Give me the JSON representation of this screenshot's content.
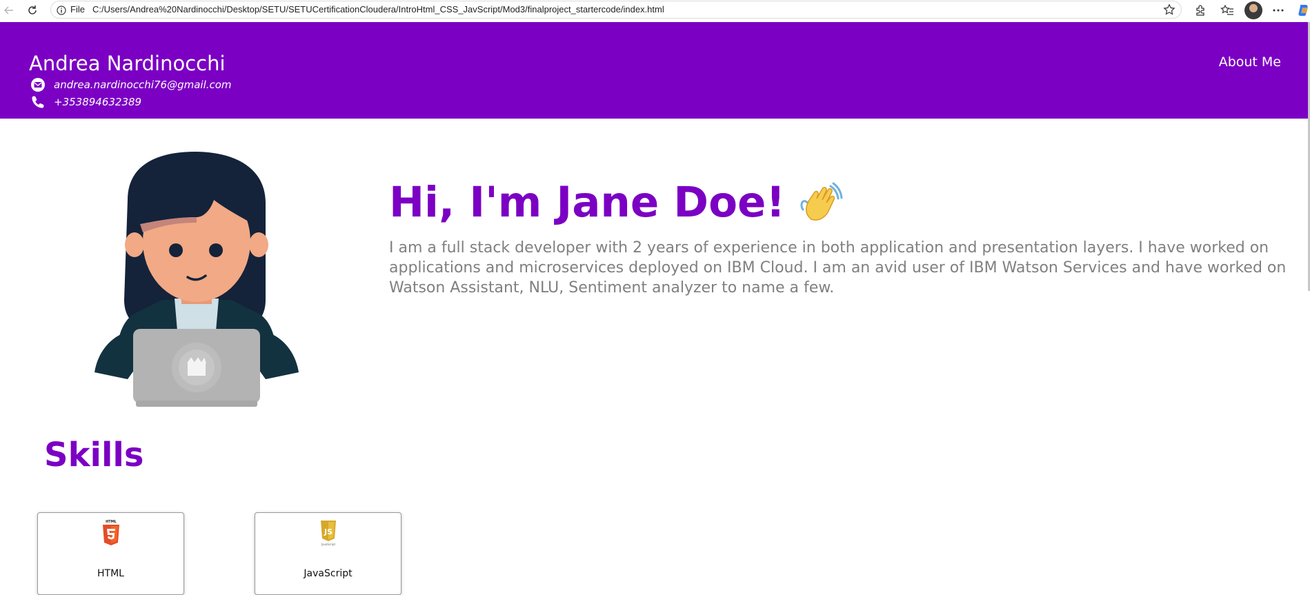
{
  "browser": {
    "file_label": "File",
    "url": "C:/Users/Andrea%20Nardinocchi/Desktop/SETU/SETUCertificationCloudera/IntroHtml_CSS_JavScript/Mod3/finalproject_startercode/index.html",
    "icons": [
      "back-icon",
      "reload-icon",
      "info-icon",
      "star-icon",
      "extensions-icon",
      "favorites-icon",
      "profile-avatar",
      "more-icon",
      "copilot-icon"
    ]
  },
  "header": {
    "name": "Andrea Nardinocchi",
    "email": "andrea.nardinocchi76@gmail.com",
    "phone": "+353894632389",
    "nav_about": "About Me",
    "background_color": "#7b00c3"
  },
  "hero": {
    "title": "Hi, I'm Jane Doe!",
    "bio": "I am a full stack developer with 2 years of experience in both application and presentation layers. I have worked on applications and microservices deployed on IBM Cloud. I am an avid user of IBM Watson Services and have worked on Watson Assistant, NLU, Sentiment analyzer to name a few.",
    "accent_color": "#7b00c3",
    "bio_color": "#808080"
  },
  "skills": {
    "title": "Skills",
    "items": [
      {
        "label": "HTML",
        "icon": "html5-icon"
      },
      {
        "label": "JavaScript",
        "icon": "javascript-icon"
      }
    ]
  }
}
